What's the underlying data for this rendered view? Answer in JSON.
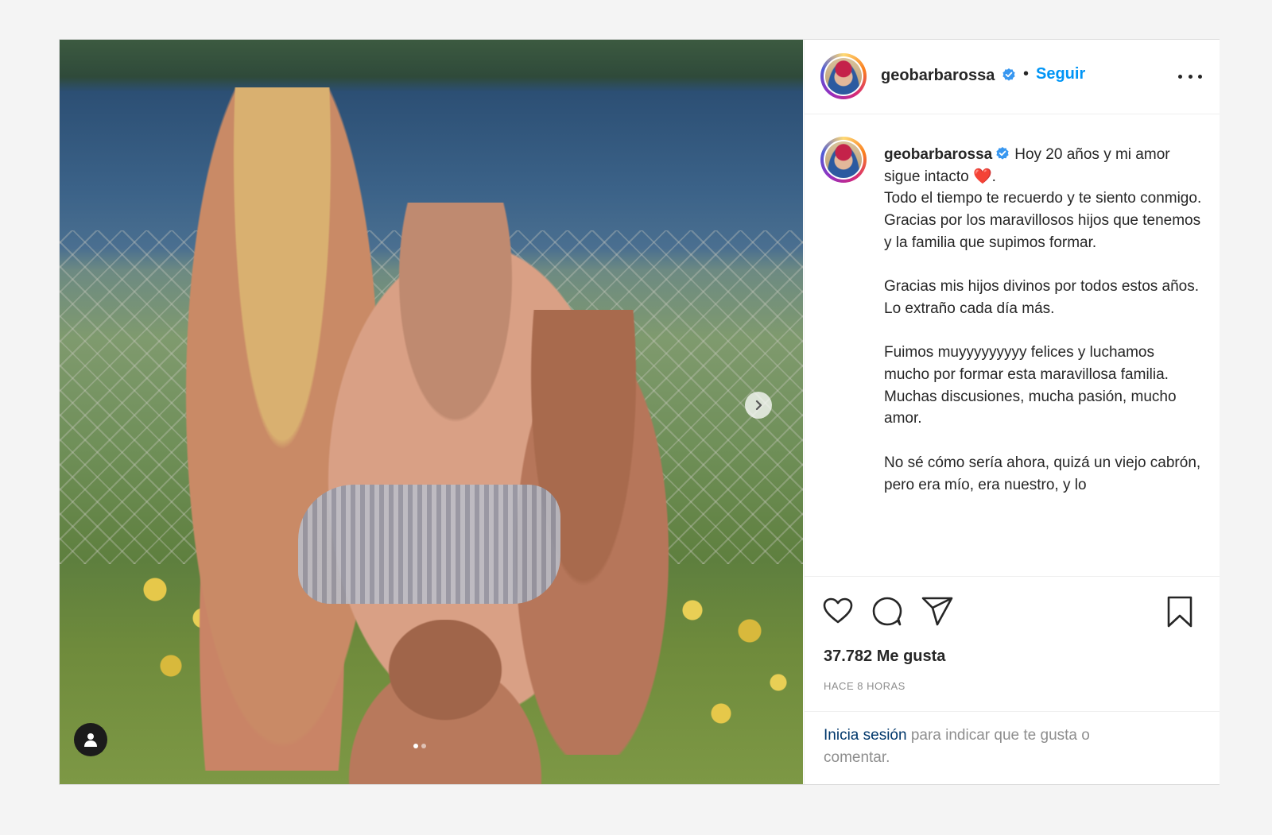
{
  "post": {
    "username": "geobarbarossa",
    "follow_label": "Seguir",
    "bullet": "•",
    "caption": {
      "username": "geobarbarossa",
      "line_first": "Hoy 20 años y mi amor sigue intacto ",
      "emoji": "❤️",
      "line_first_end": ".",
      "body": "Todo el tiempo te recuerdo y te siento conmigo.\nGracias por los maravillosos hijos que tenemos y la familia que supimos formar.\n\nGracias mis hijos divinos por todos estos años.\nLo extraño cada día más.\n\nFuimos muyyyyyyyyy felices y luchamos mucho por formar esta maravillosa familia.\nMuchas discusiones, mucha pasión, mucho amor.\n\nNo sé cómo sería ahora, quizá un viejo cabrón, pero era mío, era nuestro, y lo"
    },
    "likes": "37.782 Me gusta",
    "timestamp": "HACE 8 HORAS",
    "login_prompt": {
      "link": "Inicia sesión",
      "rest": " para indicar que te gusta o comentar."
    }
  },
  "icons": {
    "verified": "verified-badge-icon",
    "more": "more-options-icon",
    "like": "heart-icon",
    "comment": "comment-icon",
    "share": "paper-plane-icon",
    "save": "bookmark-icon",
    "next": "chevron-right-icon",
    "tags": "user-tag-icon"
  },
  "colors": {
    "link_blue": "#0095f6",
    "verified_blue": "#3897f0",
    "text": "#262626",
    "muted": "#8e8e8e"
  },
  "carousel": {
    "total_slides": 2,
    "active_slide": 1
  }
}
